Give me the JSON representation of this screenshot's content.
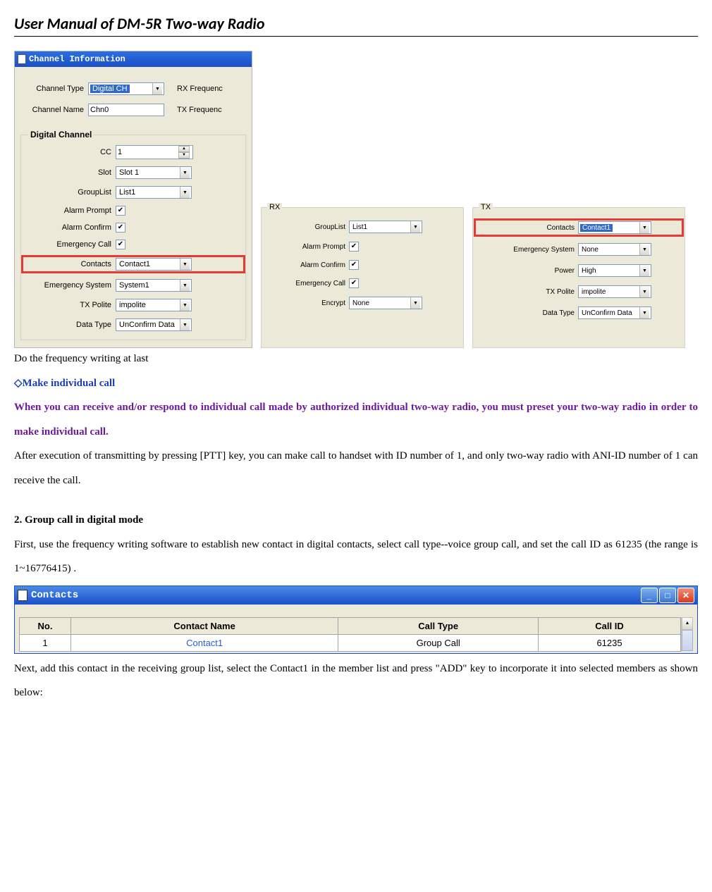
{
  "title": "User Manual of DM-5R Two-way Radio",
  "ci": {
    "winTitle": "Channel Information",
    "chType_l": "Channel Type",
    "chType_v": "Digital CH",
    "rxFreq_l": "RX Frequenc",
    "chName_l": "Channel Name",
    "chName_v": "Chn0",
    "txFreq_l": "TX Frequenc",
    "fs_legend": "Digital Channel",
    "cc_l": "CC",
    "cc_v": "1",
    "slot_l": "Slot",
    "slot_v": "Slot 1",
    "gl_l": "GroupList",
    "gl_v": "List1",
    "ap_l": "Alarm Prompt",
    "ac_l": "Alarm Confirm",
    "ec_l": "Emergency Call",
    "contacts_l": "Contacts",
    "contacts_v": "Contact1",
    "es_l": "Emergency System",
    "es_v": "System1",
    "txp_l": "TX Polite",
    "txp_v": "impolite",
    "dt_l": "Data Type",
    "dt_v": "UnConfirm Data"
  },
  "rx": {
    "legend": "RX",
    "gl_l": "GroupList",
    "gl_v": "List1",
    "ap_l": "Alarm Prompt",
    "ac_l": "Alarm Confirm",
    "ec_l": "Emergency Call",
    "enc_l": "Encrypt",
    "enc_v": "None"
  },
  "tx": {
    "legend": "TX",
    "contacts_l": "Contacts",
    "contacts_v": "Contact1",
    "es_l": "Emergency System",
    "es_v": "None",
    "pw_l": "Power",
    "pw_v": "High",
    "txp_l": "TX Polite",
    "txp_v": "impolite",
    "dt_l": "Data Type",
    "dt_v": "UnConfirm Data"
  },
  "text": {
    "line1": "Do the frequency writing at last",
    "sub1": "◇Make individual call",
    "purple": "When you can receive and/or respond to individual call made by authorized individual two-way radio, you must preset your two-way radio in order to make individual call.",
    "para1": "After execution of transmitting by pressing [PTT] key, you can make call to handset with ID number of 1, and only two-way radio with ANI-ID number of 1 can receive the call.",
    "h2": "2. Group call in digital mode",
    "para2": "First, use the frequency writing software to establish new contact in digital contacts, select call type--voice group call, and set the call ID as 61235 (the range is 1~16776415) .",
    "contacts_title": "Contacts",
    "th_no": "No.",
    "th_cn": "Contact Name",
    "th_ct": "Call Type",
    "th_id": "Call ID",
    "td_no": "1",
    "td_cn": "Contact1",
    "td_ct": "Group Call",
    "td_id": "61235",
    "para3": "Next, add this contact in the receiving group list, select the Contact1 in the member list and press \"ADD\" key to incorporate it into selected members as shown below:"
  }
}
